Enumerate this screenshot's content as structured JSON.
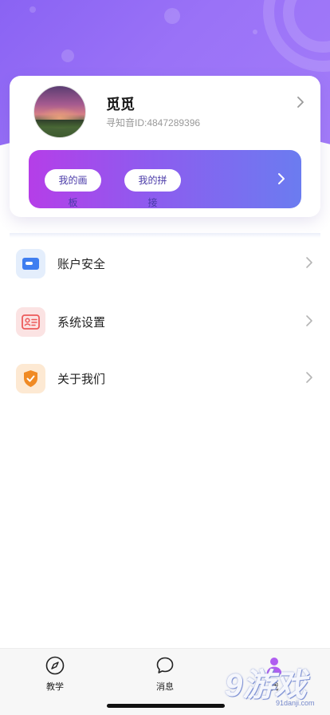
{
  "profile": {
    "name": "觅觅",
    "id_text": "寻知音ID:4847289396"
  },
  "banner": {
    "pills": [
      "我的画板",
      "我的拼接"
    ]
  },
  "menu": [
    {
      "label": "账户安全",
      "icon": "card-icon",
      "color": "#3f7ef0",
      "bg": "#e4eefc"
    },
    {
      "label": "系统设置",
      "icon": "id-card-icon",
      "color": "#ec5a5a",
      "bg": "#fbe3e3"
    },
    {
      "label": "关于我们",
      "icon": "shield-check-icon",
      "color": "#f08a24",
      "bg": "#fde9d3"
    }
  ],
  "tabbar": {
    "tabs": [
      {
        "label": "教学",
        "icon": "compass-icon"
      },
      {
        "label": "消息",
        "icon": "chat-bubble-icon"
      },
      {
        "label": "我",
        "icon": "person-icon",
        "active": true
      }
    ]
  },
  "watermark": {
    "big": "9游戏",
    "small": "91danji.com"
  },
  "colors": {
    "hero": "#9a72f7",
    "banner_start": "#b53ee8",
    "banner_end": "#6b7cf0",
    "tab_active": "#b05ef0"
  }
}
